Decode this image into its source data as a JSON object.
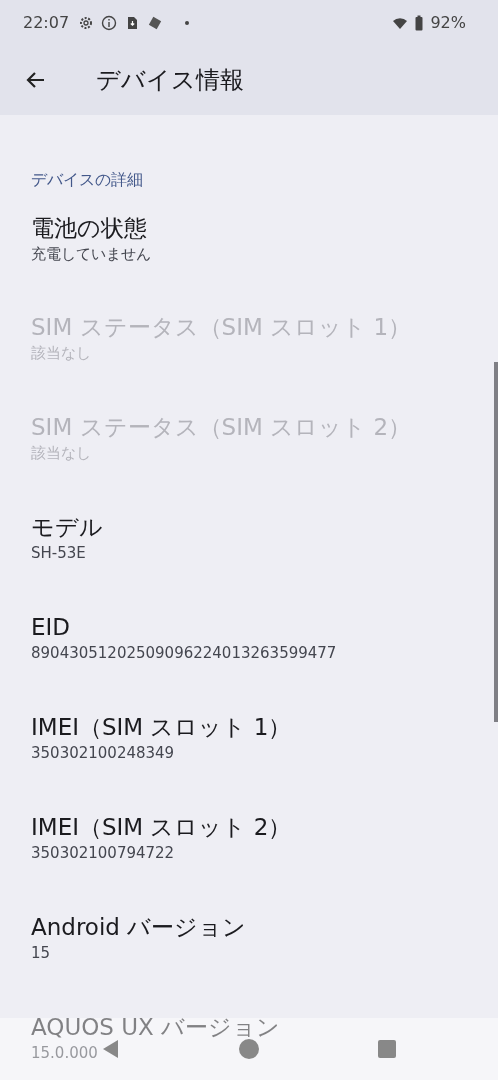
{
  "status_bar": {
    "time": "22:07",
    "battery_text": "92%"
  },
  "app_bar": {
    "title": "デバイス情報"
  },
  "section": {
    "header": "デバイスの詳細"
  },
  "items": [
    {
      "title": "電池の状態",
      "summary": "充電していません",
      "disabled": false
    },
    {
      "title": "SIM ステータス（SIM スロット 1）",
      "summary": "該当なし",
      "disabled": true
    },
    {
      "title": "SIM ステータス（SIM スロット 2）",
      "summary": "該当なし",
      "disabled": true
    },
    {
      "title": "モデル",
      "summary": "SH-53E",
      "disabled": false
    },
    {
      "title": "EID",
      "summary": "89043051202509096224013263599477",
      "disabled": false
    },
    {
      "title": "IMEI（SIM スロット 1）",
      "summary": "350302100248349",
      "disabled": false
    },
    {
      "title": "IMEI（SIM スロット 2）",
      "summary": "350302100794722",
      "disabled": false
    },
    {
      "title": "Android バージョン",
      "summary": "15",
      "disabled": false
    },
    {
      "title": "AQUOS UX バージョン",
      "summary": "15.0.000",
      "disabled": false
    }
  ]
}
